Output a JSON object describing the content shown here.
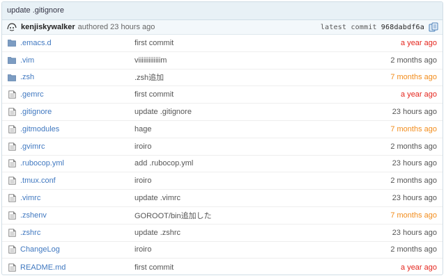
{
  "commit": {
    "title": "update .gitignore",
    "author": "kenjiskywalker",
    "authored_text": "authored 23 hours ago",
    "latest_label": "latest commit",
    "sha": "968dabdf6a"
  },
  "colors": {
    "link": "#4078c0",
    "age_red": "#e4261e",
    "age_orange": "#f28c1b",
    "age_gray": "#555555",
    "folder": "#7c9cc2"
  },
  "files": [
    {
      "type": "dir",
      "icon": "folder-icon",
      "name": ".emacs.d",
      "message": "first commit",
      "age": "a year ago",
      "age_color": "#e4261e"
    },
    {
      "type": "dir",
      "icon": "folder-icon",
      "name": ".vim",
      "message": "viiiiiiiiiiiiim",
      "age": "2 months ago",
      "age_color": "#555555"
    },
    {
      "type": "dir",
      "icon": "folder-icon",
      "name": ".zsh",
      "message": ".zsh追加",
      "age": "7 months ago",
      "age_color": "#f28c1b"
    },
    {
      "type": "file",
      "icon": "file-icon",
      "name": ".gemrc",
      "message": "first commit",
      "age": "a year ago",
      "age_color": "#e4261e"
    },
    {
      "type": "file",
      "icon": "file-icon",
      "name": ".gitignore",
      "message": "update .gitignore",
      "age": "23 hours ago",
      "age_color": "#555555"
    },
    {
      "type": "file",
      "icon": "file-icon",
      "name": ".gitmodules",
      "message": "hage",
      "age": "7 months ago",
      "age_color": "#f28c1b"
    },
    {
      "type": "file",
      "icon": "file-icon",
      "name": ".gvimrc",
      "message": "iroiro",
      "age": "2 months ago",
      "age_color": "#555555"
    },
    {
      "type": "file",
      "icon": "file-icon",
      "name": ".rubocop.yml",
      "message": "add .rubocop.yml",
      "age": "23 hours ago",
      "age_color": "#555555"
    },
    {
      "type": "file",
      "icon": "file-icon",
      "name": ".tmux.conf",
      "message": "iroiro",
      "age": "2 months ago",
      "age_color": "#555555"
    },
    {
      "type": "file",
      "icon": "file-icon",
      "name": ".vimrc",
      "message": "update .vimrc",
      "age": "23 hours ago",
      "age_color": "#555555"
    },
    {
      "type": "file",
      "icon": "file-icon",
      "name": ".zshenv",
      "message": "GOROOT/bin追加した",
      "age": "7 months ago",
      "age_color": "#f28c1b"
    },
    {
      "type": "file",
      "icon": "file-icon",
      "name": ".zshrc",
      "message": "update .zshrc",
      "age": "23 hours ago",
      "age_color": "#555555"
    },
    {
      "type": "file",
      "icon": "file-icon",
      "name": "ChangeLog",
      "message": "iroiro",
      "age": "2 months ago",
      "age_color": "#555555"
    },
    {
      "type": "file",
      "icon": "file-icon",
      "name": "README.md",
      "message": "first commit",
      "age": "a year ago",
      "age_color": "#e4261e"
    }
  ]
}
